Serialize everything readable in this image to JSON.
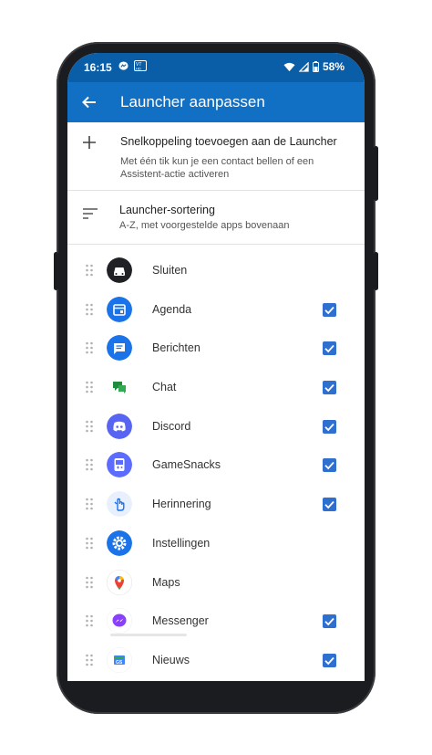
{
  "status": {
    "time": "16:15",
    "battery": "58%",
    "left_icons": [
      "messenger-icon",
      "volte-icon"
    ],
    "right_icons": [
      "wifi-icon",
      "signal-icon",
      "battery-icon"
    ]
  },
  "appbar": {
    "title": "Launcher aanpassen",
    "back_icon": "arrow-back-icon"
  },
  "add_shortcut": {
    "title": "Snelkoppeling toevoegen aan de Launcher",
    "subtitle": "Met één tik kun je een contact bellen of een Assistent-actie activeren"
  },
  "sorting": {
    "title": "Launcher-sortering",
    "subtitle": "A-Z, met voorgestelde apps bovenaan"
  },
  "apps": [
    {
      "label": "Sluiten",
      "icon": "car-icon",
      "color": "#202124",
      "checked": false
    },
    {
      "label": "Agenda",
      "icon": "calendar-icon",
      "color": "#1a73e8",
      "checked": true
    },
    {
      "label": "Berichten",
      "icon": "messages-icon",
      "color": "#1a73e8",
      "checked": true
    },
    {
      "label": "Chat",
      "icon": "chat-icon",
      "color": "#1e8e3e",
      "checked": true
    },
    {
      "label": "Discord",
      "icon": "discord-icon",
      "color": "#5865f2",
      "checked": true
    },
    {
      "label": "GameSnacks",
      "icon": "gamesnacks-icon",
      "color": "#5b6cff",
      "checked": true
    },
    {
      "label": "Herinnering",
      "icon": "reminder-hand-icon",
      "color": "#1a73e8",
      "checked": true
    },
    {
      "label": "Instellingen",
      "icon": "settings-gear-icon",
      "color": "#1a73e8",
      "checked": false
    },
    {
      "label": "Maps",
      "icon": "maps-pin-icon",
      "color": "#ea4335",
      "checked": false
    },
    {
      "label": "Messenger",
      "icon": "messenger-icon",
      "color": "#8a3ffc",
      "checked": true
    },
    {
      "label": "Nieuws",
      "icon": "news-icon",
      "color": "#4285f4",
      "checked": true
    }
  ]
}
